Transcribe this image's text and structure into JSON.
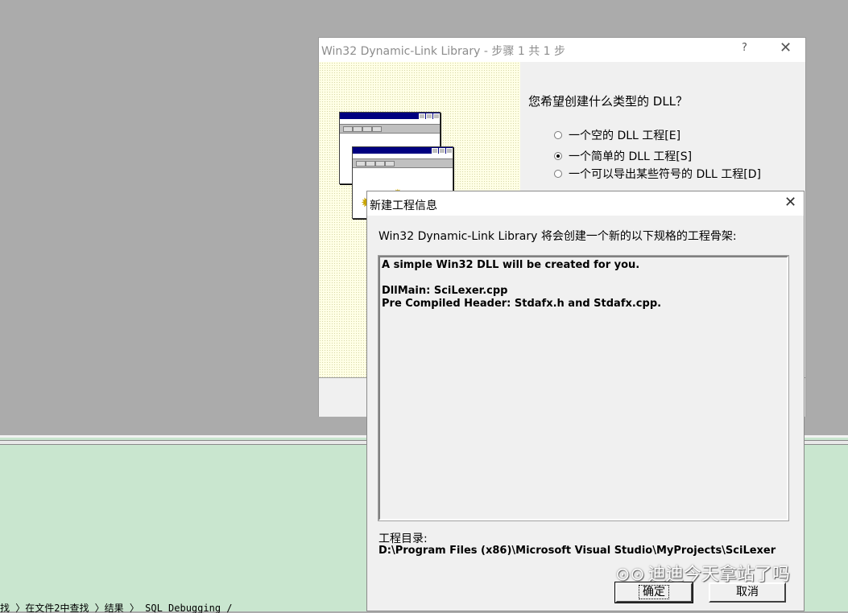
{
  "wizard": {
    "title": "Win32 Dynamic-Link Library - 步骤 1 共 1 步",
    "help_glyph": "?",
    "close_glyph": "✕",
    "question": "您希望创建什么类型的 DLL？",
    "options": [
      {
        "label": "一个空的 DLL 工程[E]",
        "selected": false
      },
      {
        "label": "一个简单的 DLL 工程[S]",
        "selected": true
      },
      {
        "label": "一个可以导出某些符号的 DLL 工程[D]",
        "selected": false
      }
    ]
  },
  "info_dialog": {
    "title": "新建工程信息",
    "close_glyph": "✕",
    "description": "Win32 Dynamic-Link Library 将会创建一个新的以下规格的工程骨架:",
    "details": [
      "A simple Win32 DLL will be created for you.",
      "",
      "DllMain: SciLexer.cpp",
      "Pre Compiled Header: Stdafx.h and Stdafx.cpp."
    ],
    "directory_label": "工程目录:",
    "directory_path": "D:\\Program Files (x86)\\Microsoft Visual Studio\\MyProjects\\SciLexer",
    "ok_label": "确定",
    "cancel_label": "取消"
  },
  "background": {
    "status_text": "找 〉在文件2中查找 〉结果 〉 SQL Debugging /"
  },
  "watermark": {
    "text": "迪迪今天拿站了吗"
  }
}
